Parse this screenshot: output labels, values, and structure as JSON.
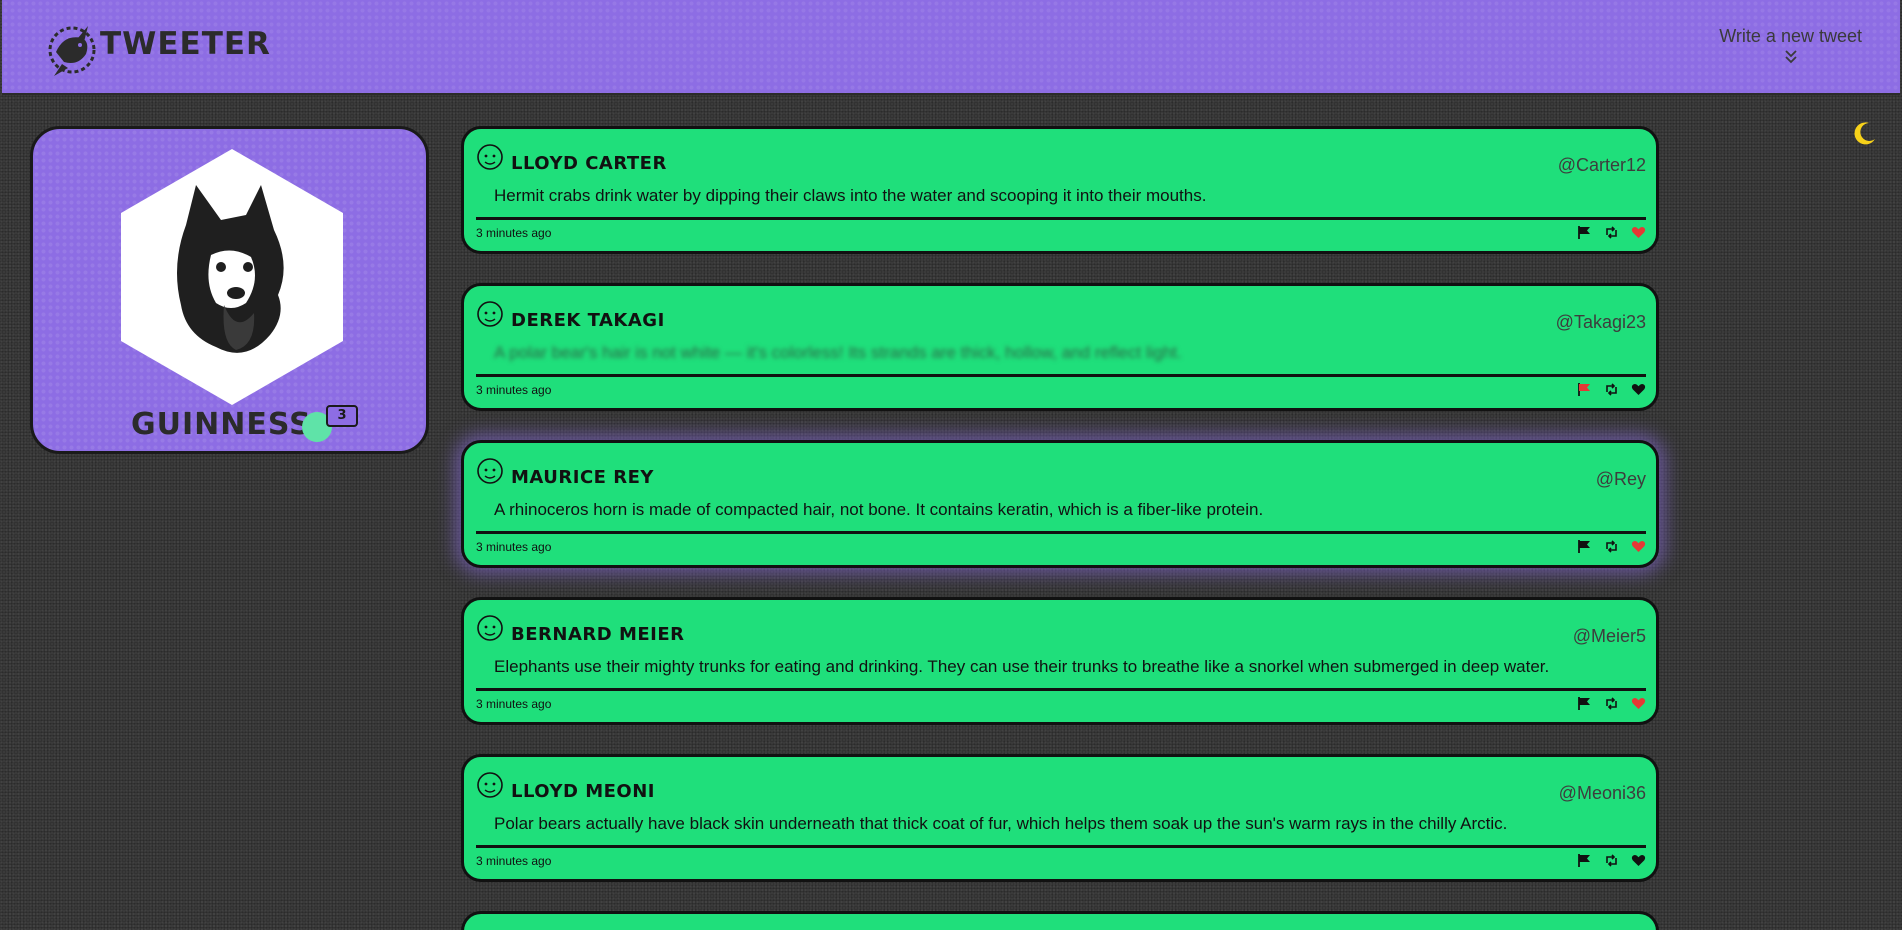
{
  "app": {
    "title": "TWEETER"
  },
  "nav": {
    "write_label": "Write  a new tweet",
    "write_icon": "double-chevron-down-icon"
  },
  "theme": {
    "toggle_icon": "moon-icon"
  },
  "colors": {
    "accent": "#8d6de4",
    "tweet_bg": "#1fdf7b",
    "heart_red": "#e53935",
    "flag_red": "#e53935",
    "moon": "#f7d21a",
    "page_bg": "#3a3a3a"
  },
  "profile": {
    "name": "GUINNESS",
    "count": "3"
  },
  "tweets": [
    {
      "name": "LLOYD CARTER",
      "handle": "@Carter12",
      "text": "Hermit crabs drink water by dipping their claws into the water and scooping it into their mouths.",
      "time": "3 minutes ago",
      "flagged": false,
      "liked": true,
      "blurred": false,
      "glow": false
    },
    {
      "name": "DEREK TAKAGI",
      "handle": "@Takagi23",
      "text": "A polar bear's hair is not white — it's colorless! Its strands are thick, hollow, and reflect light.",
      "time": "3 minutes ago",
      "flagged": true,
      "liked": false,
      "blurred": true,
      "glow": false
    },
    {
      "name": "MAURICE REY",
      "handle": "@Rey",
      "text": "A rhinoceros horn is made of compacted hair, not bone. It contains keratin, which is a fiber-like protein.",
      "time": "3 minutes ago",
      "flagged": false,
      "liked": true,
      "blurred": false,
      "glow": true
    },
    {
      "name": "BERNARD MEIER",
      "handle": "@Meier5",
      "text": "Elephants use their mighty trunks for eating and drinking. They can use their trunks to breathe like a snorkel when submerged in deep water.",
      "time": "3 minutes ago",
      "flagged": false,
      "liked": true,
      "blurred": false,
      "glow": false
    },
    {
      "name": "LLOYD MEONI",
      "handle": "@Meoni36",
      "text": "Polar bears actually have black skin underneath that thick coat of fur, which helps them soak up the sun's warm rays in the chilly Arctic.",
      "time": "3 minutes ago",
      "flagged": false,
      "liked": false,
      "blurred": false,
      "glow": false
    }
  ]
}
